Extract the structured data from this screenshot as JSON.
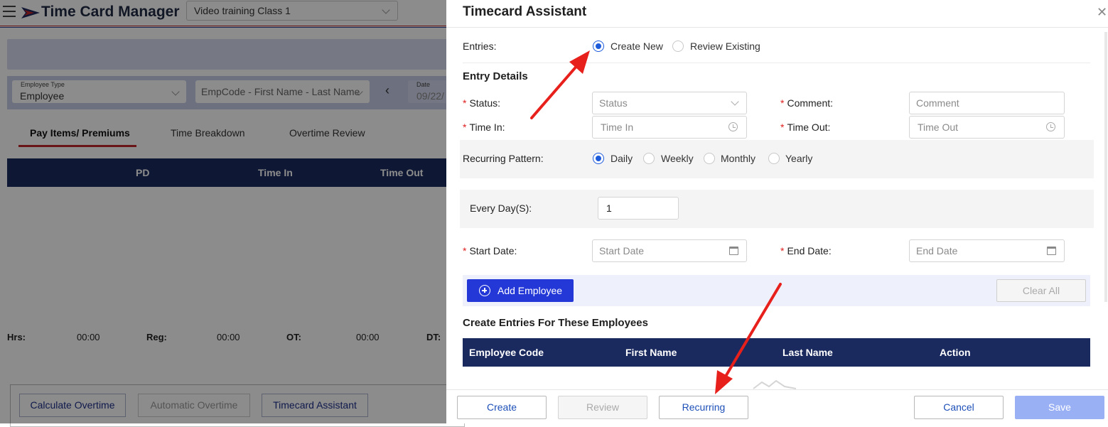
{
  "app": {
    "title": "Time Card Manager",
    "class_select": "Video training Class 1",
    "filters": {
      "employee_type_label": "Employee Type",
      "employee_type_value": "Employee",
      "empcode_value": "EmpCode - First Name - Last Name",
      "date_label": "Date",
      "date_value": "09/22/"
    },
    "tabs": [
      "Pay Items/ Premiums",
      "Time Breakdown",
      "Overtime Review"
    ],
    "table_headers": [
      "PD",
      "Time In",
      "Time Out"
    ],
    "totals": [
      {
        "label": "Hrs:",
        "value": "00:00"
      },
      {
        "label": "Reg:",
        "value": "00:00"
      },
      {
        "label": "OT:",
        "value": "00:00"
      },
      {
        "label": "DT:",
        "value": ""
      }
    ],
    "bottom_buttons": [
      "Calculate Overtime",
      "Automatic Overtime",
      "Timecard Assistant"
    ]
  },
  "drawer": {
    "title": "Timecard Assistant",
    "entries_label": "Entries:",
    "entries_options": [
      "Create New",
      "Review Existing"
    ],
    "entries_selected": "Create New",
    "entry_details_title": "Entry Details",
    "status_label": "Status:",
    "status_placeholder": "Status",
    "comment_label": "Comment:",
    "comment_placeholder": "Comment",
    "time_in_label": "Time In:",
    "time_in_placeholder": "Time In",
    "time_out_label": "Time Out:",
    "time_out_placeholder": "Time Out",
    "recurring_label": "Recurring Pattern:",
    "recurring_options": [
      "Daily",
      "Weekly",
      "Monthly",
      "Yearly"
    ],
    "recurring_selected": "Daily",
    "every_days_label": "Every Day(S):",
    "every_days_value": "1",
    "start_date_label": "Start Date:",
    "start_date_placeholder": "Start Date",
    "end_date_label": "End Date:",
    "end_date_placeholder": "End Date",
    "add_employee": "Add Employee",
    "clear_all": "Clear All",
    "employees_title": "Create Entries For These Employees",
    "employee_columns": [
      "Employee Code",
      "First Name",
      "Last Name",
      "Action"
    ],
    "footer_buttons": {
      "create": "Create",
      "review": "Review",
      "recurring": "Recurring",
      "cancel": "Cancel",
      "save": "Save"
    }
  },
  "colors": {
    "primary": "#2438d8",
    "navy_header": "#1a2a5e",
    "annotation_arrow": "#e8201c",
    "required_star": "#e02020"
  }
}
